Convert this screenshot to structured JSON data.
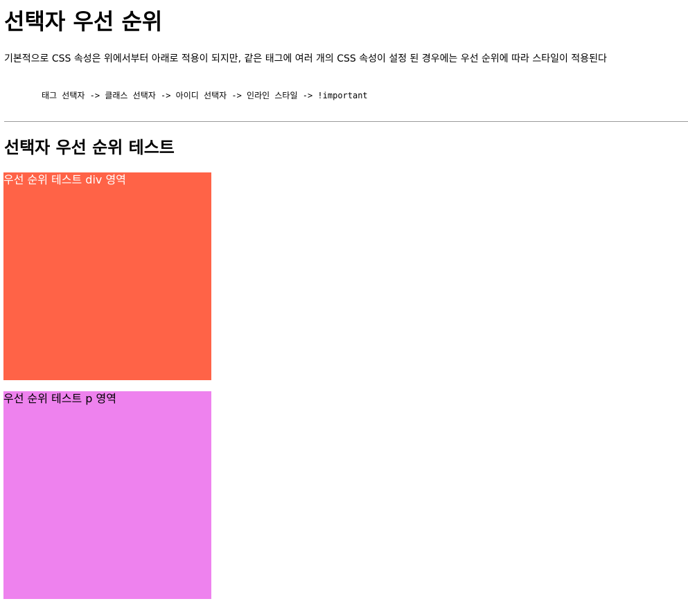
{
  "heading": "선택자 우선 순위",
  "intro": "기본적으로 CSS 속성은 위에서부터 아래로 적용이 되지만, 같은 태그에 여러 개의 CSS 속성이 설정 된 경우에는 우선 순위에 따라 스타일이 적용된다",
  "priority_order": "태그 선택자 -> 클래스 선택자 -> 아이디 선택자 -> 인라인 스타일 -> !important",
  "test_section": {
    "heading": "선택자 우선 순위 테스트",
    "div_box": {
      "text": "우선 순위 테스트 div 영역",
      "background": "#ff6347",
      "text_color": "#ffffff"
    },
    "p_box": {
      "text": "우선 순위 테스트 p 영역",
      "background": "#ee82ee",
      "text_color": "#000000"
    }
  }
}
